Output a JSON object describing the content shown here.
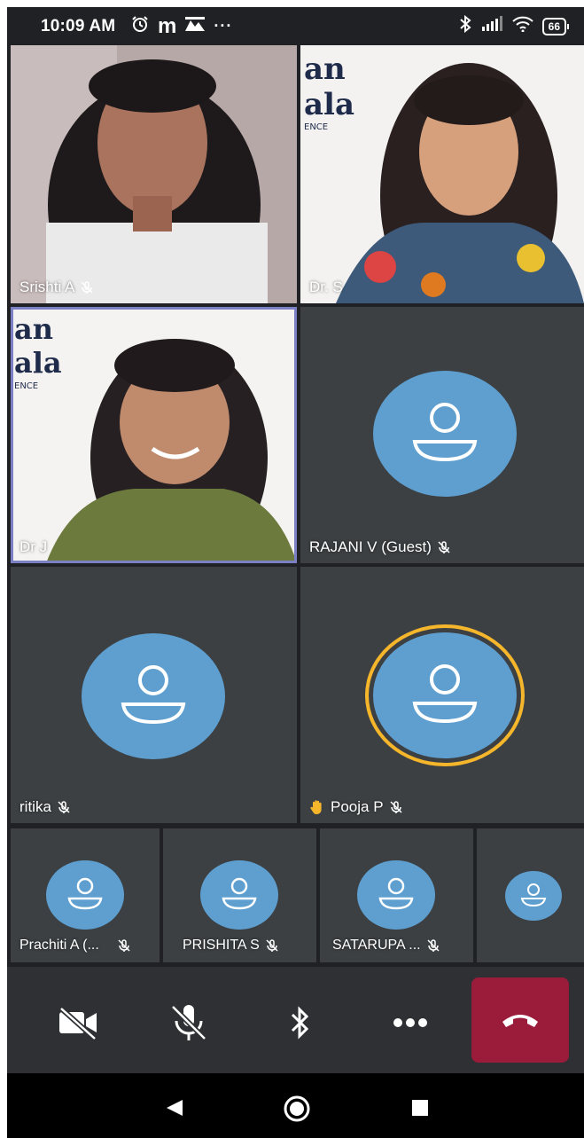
{
  "status_bar": {
    "time": "10:09 AM",
    "left_icons": [
      "alarm-icon",
      "m-app-icon",
      "gallery-icon",
      "more-dots-icon"
    ],
    "right_icons": [
      "bluetooth-icon",
      "signal-icon",
      "wifi-icon",
      "battery-icon"
    ],
    "battery_level": "66"
  },
  "participants": [
    {
      "name": "Srishti A",
      "muted": true,
      "has_video": true
    },
    {
      "name": "Dr. S",
      "muted": false,
      "has_video": true
    },
    {
      "name": "Dr J",
      "muted": false,
      "has_video": true,
      "pinned": true
    },
    {
      "name": "RAJANI V (Guest)",
      "muted": true,
      "has_video": false
    },
    {
      "name": "ritika",
      "muted": true,
      "has_video": false
    },
    {
      "name": "Pooja P",
      "muted": true,
      "has_video": false,
      "hand_raised": true,
      "speaking": true
    },
    {
      "name": "Prachiti A (...",
      "muted": true,
      "has_video": false
    },
    {
      "name": "PRISHITA S",
      "muted": true,
      "has_video": false
    },
    {
      "name": "SATARUPA ...",
      "muted": true,
      "has_video": false
    }
  ],
  "controls": [
    {
      "name": "camera-off-icon",
      "label": "Turn on camera"
    },
    {
      "name": "mic-off-icon",
      "label": "Unmute"
    },
    {
      "name": "bluetooth-icon",
      "label": "Audio output"
    },
    {
      "name": "more-options-icon",
      "label": "More options"
    },
    {
      "name": "end-call-icon",
      "label": "Leave call"
    }
  ],
  "colors": {
    "background": "#202124",
    "tile": "#3c4043",
    "avatar": "#5e9fd0",
    "speaking_ring": "#f5b62c",
    "end_call": "#9b1c3a",
    "pinned_border": "#7b7fc4"
  },
  "nav_bar": [
    "back-icon",
    "home-icon",
    "recents-icon"
  ]
}
